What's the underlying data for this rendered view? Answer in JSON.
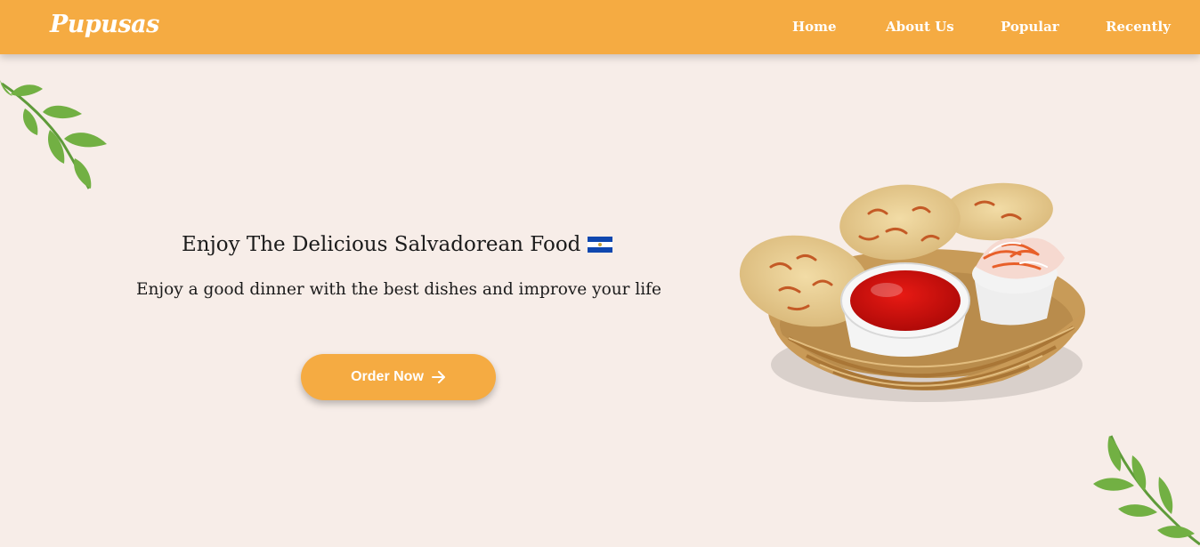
{
  "header": {
    "logo": "Pupusas",
    "nav": [
      {
        "label": "Home"
      },
      {
        "label": "About Us"
      },
      {
        "label": "Popular"
      },
      {
        "label": "Recently"
      }
    ]
  },
  "hero": {
    "title": "Enjoy The Delicious Salvadorean Food",
    "subtitle": "Enjoy a good dinner with the best dishes and improve your life",
    "button_label": "Order Now",
    "button_icon": "arrow-right-icon",
    "flag_icon": "el-salvador-flag-icon"
  },
  "colors": {
    "accent": "#f5ab42",
    "background": "#f7ede8",
    "leaf": "#72b043"
  }
}
